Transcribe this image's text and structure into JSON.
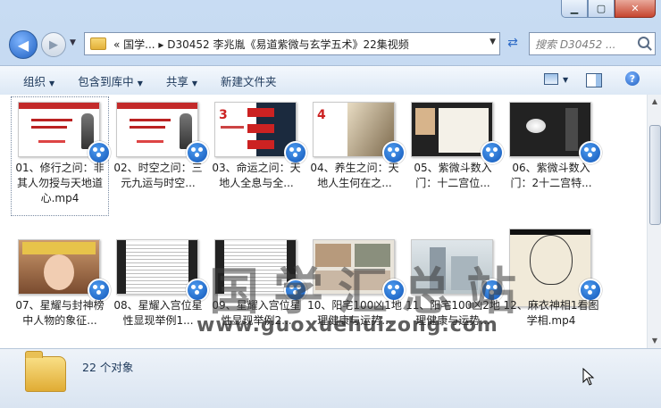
{
  "window": {
    "controls": {
      "minimize": "▁",
      "maximize": "▢",
      "close": "✕"
    }
  },
  "address": {
    "back_glyph": "◀",
    "forward_glyph": "▶",
    "breadcrumb": "«   国学...   ▸  D30452 李兆胤《易道紫微与玄学五术》22集视频",
    "search_placeholder": "搜索 D30452 ..."
  },
  "toolbar": {
    "organize": "组织",
    "include_library": "包含到库中",
    "share": "共享",
    "new_folder": "新建文件夹",
    "help": "?"
  },
  "files": [
    {
      "name": "01、修行之问：非其人勿授与天地道心.mp4",
      "thumb": "ppt",
      "selected": true
    },
    {
      "name": "02、时空之问：三元九运与时空...",
      "thumb": "ppt"
    },
    {
      "name": "03、命运之问：天地人全息与全...",
      "thumb": "slide"
    },
    {
      "name": "04、养生之问：天地人生何在之...",
      "thumb": "slide2"
    },
    {
      "name": "05、紫微斗数入门：十二宫位...",
      "thumb": "book"
    },
    {
      "name": "06、紫微斗数入门：2十二宫特...",
      "thumb": "dark"
    },
    {
      "name": "07、星耀与封神榜中人物的象征...",
      "thumb": "girl"
    },
    {
      "name": "08、星耀入宫位星性显现举例1...",
      "thumb": "text"
    },
    {
      "name": "09、星耀入宫位星性显现举例2...",
      "thumb": "text"
    },
    {
      "name": "10、阳宅100凶1地理健康与运势...",
      "thumb": "house"
    },
    {
      "name": "11、阳宅100凶2地理健康与运势...",
      "thumb": "build"
    },
    {
      "name": "12、麻衣神相1看图学相.mp4",
      "thumb": "face"
    }
  ],
  "watermark": {
    "text": "国学汇总站",
    "url": "www.guoxuehuizong.com"
  },
  "status": {
    "count": "22 个对象"
  }
}
